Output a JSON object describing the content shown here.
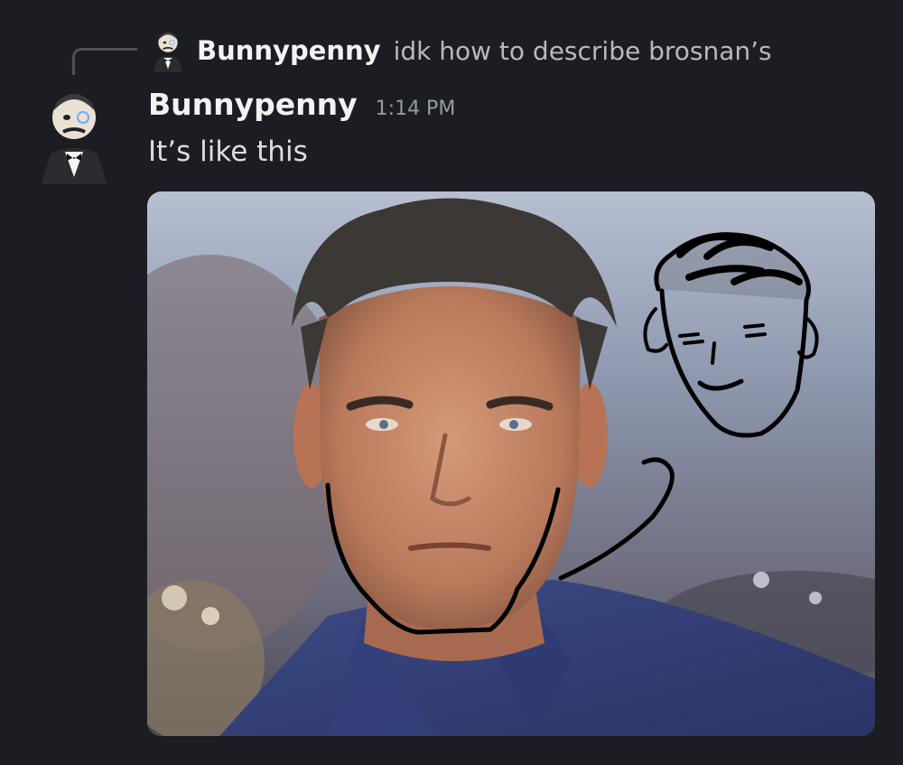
{
  "reply": {
    "author": "Bunnypenny",
    "text": "idk how to describe brosnan’s",
    "avatar_icon": "butler-monocle-avatar-icon"
  },
  "message": {
    "author": "Bunnypenny",
    "timestamp": "1:14 PM",
    "text": "It’s like this",
    "avatar_icon": "butler-monocle-avatar-icon"
  },
  "attachment": {
    "kind": "image",
    "content": "photo-with-doodle"
  },
  "colors": {
    "background": "#1c1d22",
    "author": "#f2f3f5",
    "message_text": "#dbdee1",
    "muted_text": "#b5bac1",
    "timestamp": "#949ba4"
  }
}
